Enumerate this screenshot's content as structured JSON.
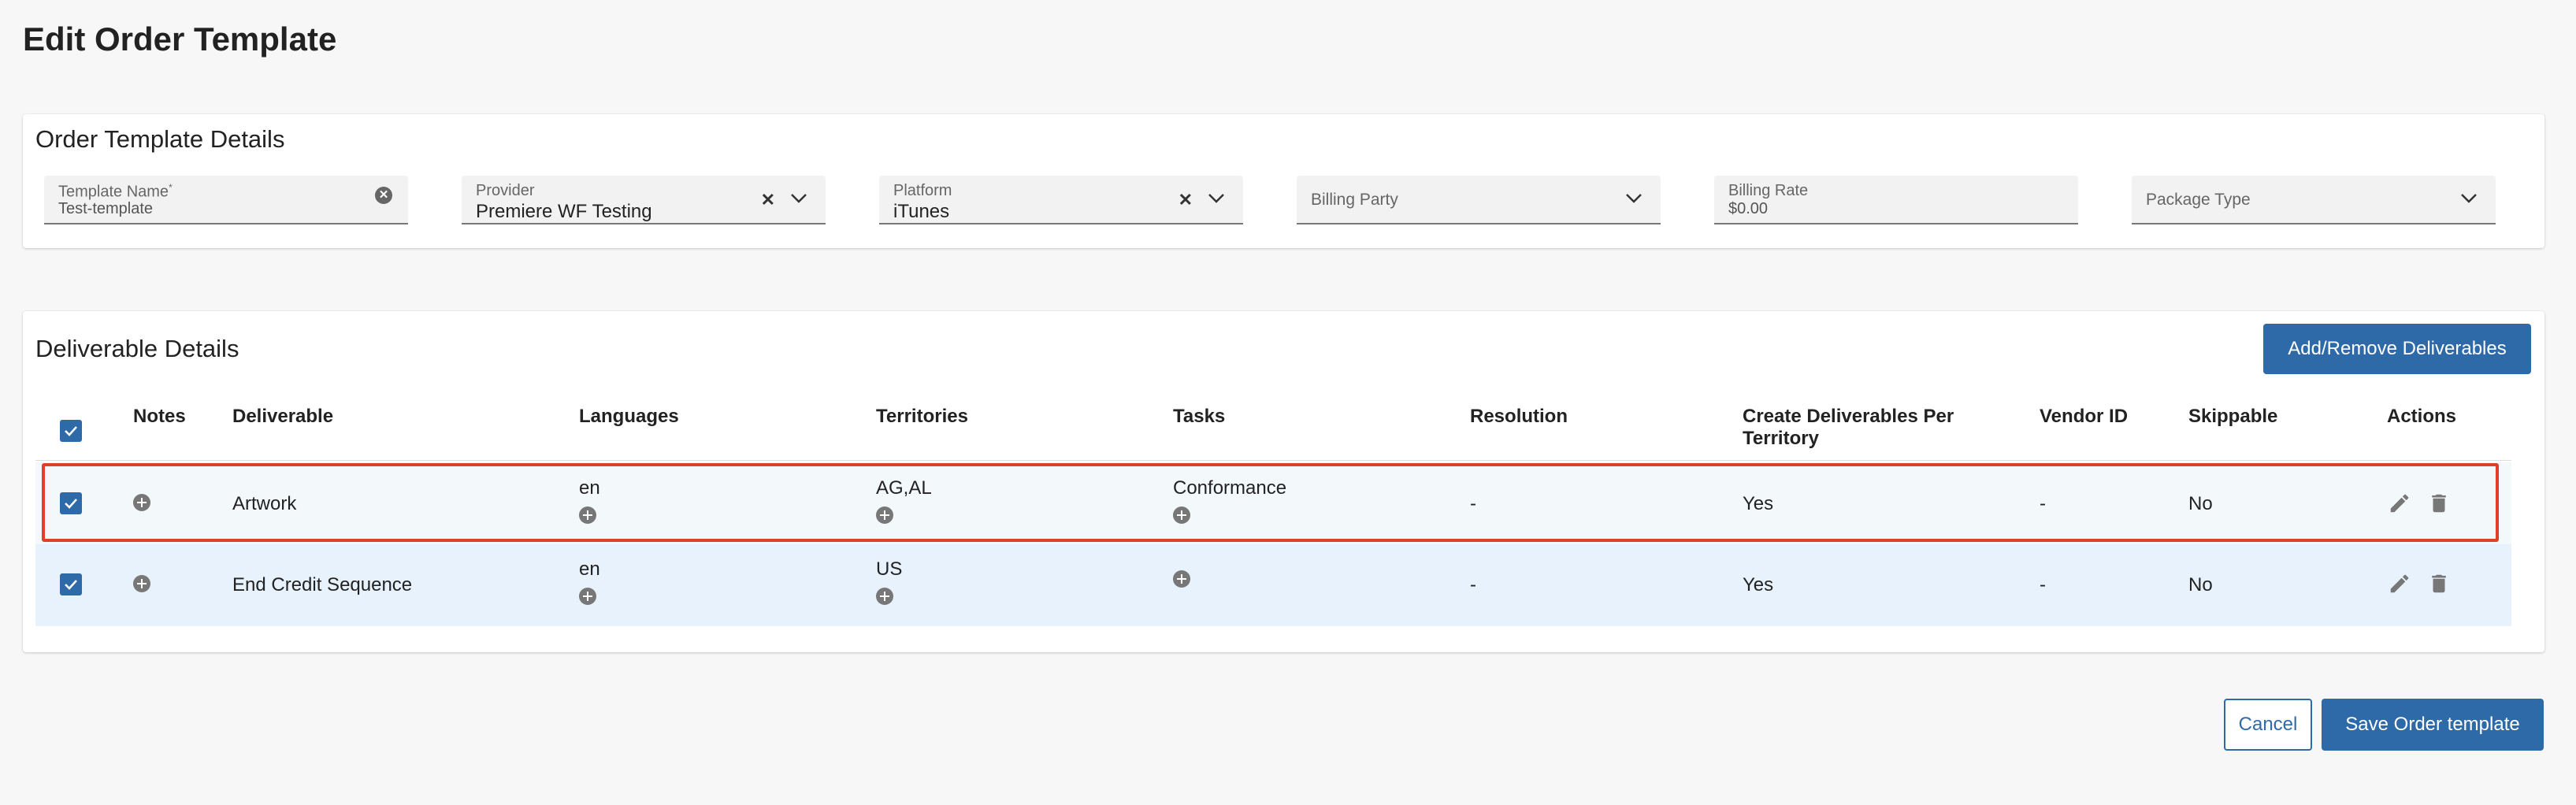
{
  "page": {
    "title": "Edit Order Template"
  },
  "order_details": {
    "title": "Order Template Details",
    "fields": [
      {
        "label": "Template Name",
        "required_mark": "*",
        "value": "Test-template"
      },
      {
        "label": "Provider",
        "value": "Premiere WF Testing"
      },
      {
        "label": "Platform",
        "value": "iTunes"
      },
      {
        "label": "Billing Party",
        "value": ""
      },
      {
        "label": "Billing Rate",
        "value": "$0.00"
      },
      {
        "label": "Package Type",
        "value": ""
      }
    ]
  },
  "deliverables": {
    "title": "Deliverable Details",
    "add_remove_label": "Add/Remove Deliverables",
    "columns": [
      "Notes",
      "Deliverable",
      "Languages",
      "Territories",
      "Tasks",
      "Resolution",
      "Create Deliverables Per Territory",
      "Vendor ID",
      "Skippable",
      "Actions"
    ],
    "rows": [
      {
        "checked": true,
        "deliverable": "Artwork",
        "languages": "en",
        "territories": "AG,AL",
        "tasks": "Conformance",
        "resolution": "-",
        "per_territory": "Yes",
        "vendor_id": "-",
        "skippable": "No"
      },
      {
        "checked": true,
        "deliverable": "End Credit Sequence",
        "languages": "en",
        "territories": "US",
        "tasks": "",
        "resolution": "-",
        "per_territory": "Yes",
        "vendor_id": "-",
        "skippable": "No"
      }
    ]
  },
  "footer": {
    "cancel_label": "Cancel",
    "save_label": "Save Order template"
  },
  "colors": {
    "primary": "#2f6aa8",
    "highlight": "#e0402b",
    "row_selected": "#e8f2fc"
  },
  "icons": [
    "clear-circle-icon",
    "clear-x-icon",
    "chevron-down-icon",
    "check-icon",
    "plus-circle-icon",
    "pencil-icon",
    "trash-icon"
  ]
}
